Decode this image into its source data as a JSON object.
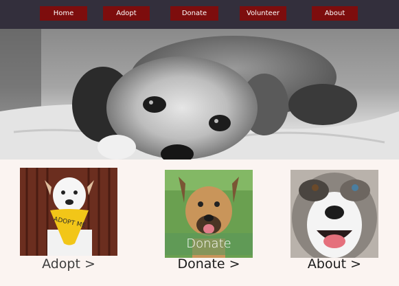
{
  "nav": {
    "items": [
      {
        "label": "Home"
      },
      {
        "label": "Adopt"
      },
      {
        "label": "Donate"
      },
      {
        "label": "Volunteer"
      },
      {
        "label": "About"
      }
    ]
  },
  "cards": [
    {
      "link": "Adopt >",
      "bandana_text": "ADOPT ME"
    },
    {
      "link": "Donate >",
      "overlay": "Donate"
    },
    {
      "link": "About >"
    }
  ],
  "colors": {
    "nav_bg": "#332f3c",
    "nav_button": "#7d0d0d",
    "page_bg": "#fbf4f1",
    "overlay_green": "#5a965a"
  }
}
